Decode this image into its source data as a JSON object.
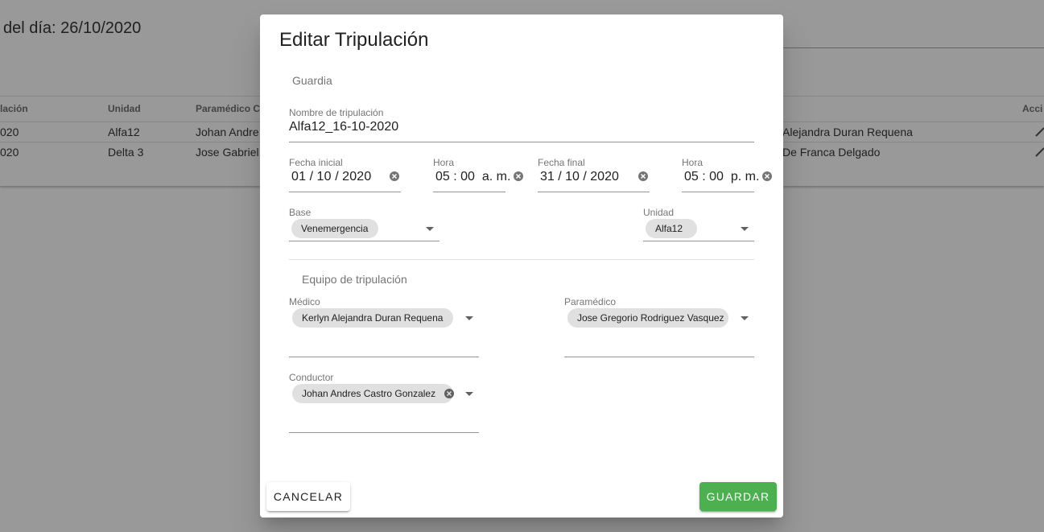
{
  "background": {
    "title": "del día: 26/10/2020",
    "table": {
      "headers": [
        "lación",
        "Unidad",
        "Paramédico C",
        "Acci"
      ],
      "rows": [
        {
          "c1": "020",
          "unidad": "Alfa12",
          "paramedico": "Johan Andre",
          "medico": "Alejandra Duran Requena"
        },
        {
          "c1": "020",
          "unidad": "Delta 3",
          "paramedico": "Jose Gabriel",
          "medico": "De Franca Delgado"
        }
      ]
    }
  },
  "dialog": {
    "title": "Editar Tripulación",
    "section_guardia": "Guardia",
    "nombre": {
      "label": "Nombre de tripulación",
      "value": "Alfa12_16-10-2020"
    },
    "fecha_inicial": {
      "label": "Fecha inicial",
      "day": "01",
      "month": "10",
      "year": "2020"
    },
    "hora_inicial": {
      "label": "Hora",
      "hour": "05",
      "minute": "00",
      "period": "a. m."
    },
    "fecha_final": {
      "label": "Fecha final",
      "day": "31",
      "month": "10",
      "year": "2020"
    },
    "hora_final": {
      "label": "Hora",
      "hour": "05",
      "minute": "00",
      "period": "p. m."
    },
    "base": {
      "label": "Base",
      "value": "Venemergencia"
    },
    "unidad": {
      "label": "Unidad",
      "value": "Alfa12"
    },
    "section_equipo": "Equipo de tripulación",
    "medico": {
      "label": "Médico",
      "value": "Kerlyn Alejandra Duran Requena"
    },
    "paramedico": {
      "label": "Paramédico",
      "value": "Jose Gregorio Rodriguez Vasquez"
    },
    "conductor": {
      "label": "Conductor",
      "value": "Johan Andres Castro Gonzalez"
    },
    "cancel_label": "CANCELAR",
    "save_label": "GUARDAR"
  },
  "colors": {
    "save_button": "#4caf50",
    "overlay": "#212121",
    "chip": "#e0e0e0"
  },
  "icons": {
    "clear": "clear-circle-icon",
    "dropdown": "dropdown-caret-icon",
    "edit": "pencil-icon"
  }
}
